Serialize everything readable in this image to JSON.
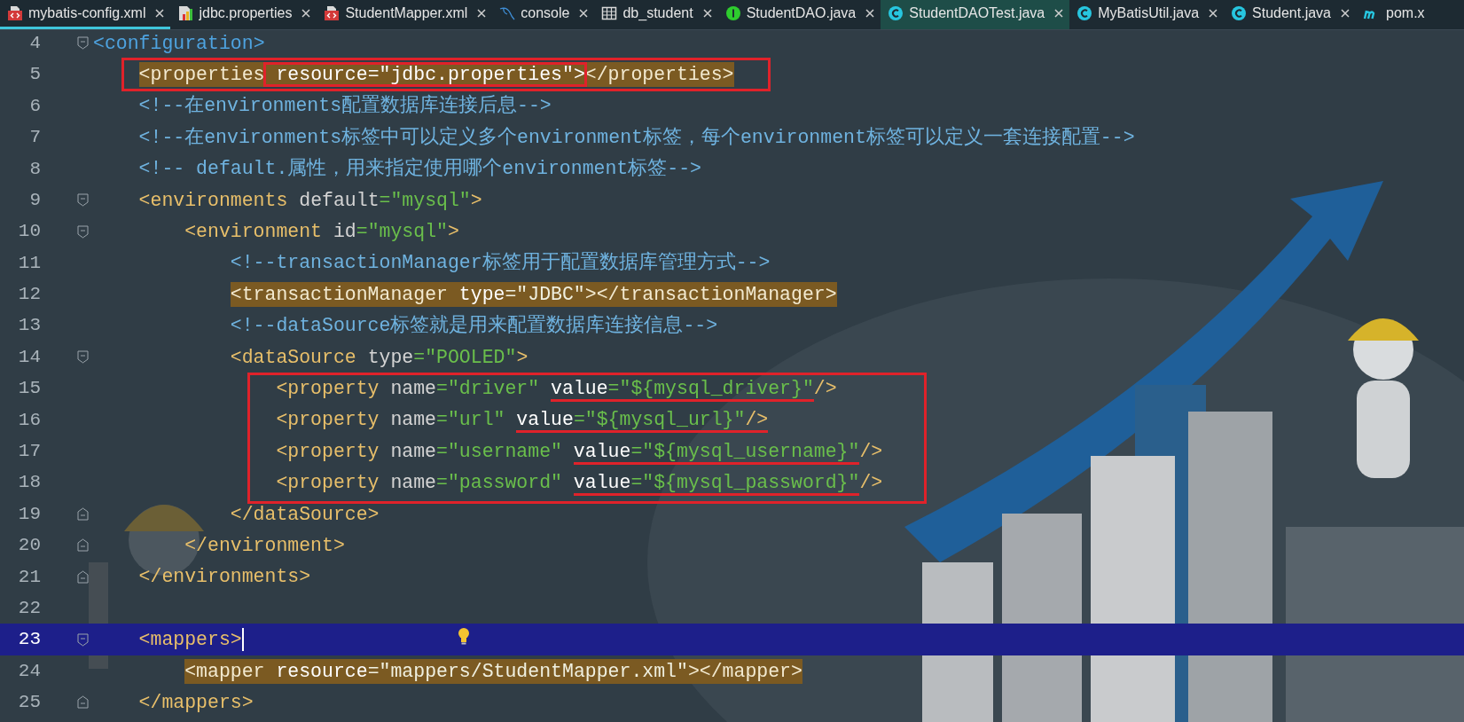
{
  "tabs": [
    {
      "label": "mybatis-config.xml",
      "kind": "xml",
      "selected": true,
      "highlighted": false
    },
    {
      "label": "jdbc.properties",
      "kind": "properties",
      "selected": false,
      "highlighted": false
    },
    {
      "label": "StudentMapper.xml",
      "kind": "xml",
      "selected": false,
      "highlighted": false
    },
    {
      "label": "console",
      "kind": "console",
      "selected": false,
      "highlighted": false
    },
    {
      "label": "db_student",
      "kind": "table",
      "selected": false,
      "highlighted": false
    },
    {
      "label": "StudentDAO.java",
      "kind": "interface",
      "selected": false,
      "highlighted": false
    },
    {
      "label": "StudentDAOTest.java",
      "kind": "class",
      "selected": false,
      "highlighted": true
    },
    {
      "label": "MyBatisUtil.java",
      "kind": "class",
      "selected": false,
      "highlighted": false
    },
    {
      "label": "Student.java",
      "kind": "class",
      "selected": false,
      "highlighted": false
    },
    {
      "label": "pom.x",
      "kind": "maven",
      "selected": false,
      "highlighted": false
    }
  ],
  "editor": {
    "lines": [
      {
        "kind": "line",
        "number": "4",
        "highlighted": false,
        "current": false,
        "tokens": [
          {
            "kind": "tag_blue",
            "text": "<configuration>"
          }
        ],
        "children": [
          {
            "kind": "annotation_box",
            "lines": [
              {
                "kind": "line",
                "number": "5",
                "highlighted": true,
                "current": false,
                "tokens": [
                  {
                    "kind": "tag",
                    "text": "<properties"
                  },
                  {
                    "kind": "attr",
                    "text": " resource=\"jdbc.properties\">",
                    "boxed": true
                  },
                  {
                    "kind": "tag",
                    "text": "</properties>"
                  }
                ]
              }
            ]
          },
          {
            "kind": "line",
            "number": "6",
            "highlighted": false,
            "current": false,
            "tokens": [
              {
                "kind": "comment",
                "text": "<!--在environments配置数据库连接后息-->"
              }
            ]
          },
          {
            "kind": "line",
            "number": "7",
            "highlighted": false,
            "current": false,
            "tokens": [
              {
                "kind": "comment",
                "text": "<!--在environments标签中可以定义多个environment标签，每个environment标签可以定义一套连接配置-->"
              }
            ]
          },
          {
            "kind": "line",
            "number": "8",
            "highlighted": false,
            "current": false,
            "tokens": [
              {
                "kind": "comment",
                "text": "<!-- default.属性，用来指定使用哪个environment标签-->"
              }
            ]
          },
          {
            "kind": "line",
            "number": "9",
            "highlighted": false,
            "current": false,
            "tokens": [
              {
                "kind": "tag",
                "text": "<environments"
              },
              {
                "kind": "attr",
                "text": " default"
              },
              {
                "kind": "value",
                "text": "=\"mysql\""
              },
              {
                "kind": "tag",
                "text": ">"
              }
            ],
            "children": [
              {
                "kind": "line",
                "number": "10",
                "highlighted": false,
                "current": false,
                "tokens": [
                  {
                    "kind": "tag",
                    "text": "<environment"
                  },
                  {
                    "kind": "attr",
                    "text": " id"
                  },
                  {
                    "kind": "value",
                    "text": "=\"mysql\""
                  },
                  {
                    "kind": "tag",
                    "text": ">"
                  }
                ],
                "children": [
                  {
                    "kind": "line",
                    "number": "11",
                    "highlighted": false,
                    "current": false,
                    "tokens": [
                      {
                        "kind": "comment",
                        "text": "<!--transactionManager标签用于配置数据库管理方式-->"
                      }
                    ]
                  },
                  {
                    "kind": "line",
                    "number": "12",
                    "highlighted": true,
                    "current": false,
                    "tokens": [
                      {
                        "kind": "tag",
                        "text": "<transactionManager"
                      },
                      {
                        "kind": "attr",
                        "text": " type"
                      },
                      {
                        "kind": "value",
                        "text": "=\"JDBC\""
                      },
                      {
                        "kind": "tag",
                        "text": "></transactionManager>"
                      }
                    ]
                  },
                  {
                    "kind": "line",
                    "number": "13",
                    "highlighted": false,
                    "current": false,
                    "tokens": [
                      {
                        "kind": "comment",
                        "text": "<!--dataSource标签就是用来配置数据库连接信息-->"
                      }
                    ]
                  },
                  {
                    "kind": "line",
                    "number": "14",
                    "highlighted": false,
                    "current": false,
                    "tokens": [
                      {
                        "kind": "tag",
                        "text": "<dataSource"
                      },
                      {
                        "kind": "attr",
                        "text": " type"
                      },
                      {
                        "kind": "value",
                        "text": "=\"POOLED\""
                      },
                      {
                        "kind": "tag",
                        "text": ">"
                      }
                    ],
                    "children": [
                      {
                        "kind": "annotation_box",
                        "lines": [
                          {
                            "kind": "line",
                            "number": "15",
                            "highlighted": false,
                            "current": false,
                            "tokens": [
                              {
                                "kind": "tag",
                                "text": "<property"
                              },
                              {
                                "kind": "attr",
                                "text": " name"
                              },
                              {
                                "kind": "value",
                                "text": "=\"driver\" "
                              },
                              {
                                "kind": "match",
                                "text": "value",
                                "underlined": true
                              },
                              {
                                "kind": "value",
                                "text": "=\"${mysql_driver}\"",
                                "underlined": true
                              },
                              {
                                "kind": "tag",
                                "text": "/>"
                              }
                            ]
                          },
                          {
                            "kind": "line",
                            "number": "16",
                            "highlighted": false,
                            "current": false,
                            "tokens": [
                              {
                                "kind": "tag",
                                "text": "<property"
                              },
                              {
                                "kind": "attr",
                                "text": " name"
                              },
                              {
                                "kind": "value",
                                "text": "=\"url\" "
                              },
                              {
                                "kind": "match",
                                "text": "value",
                                "underlined": true
                              },
                              {
                                "kind": "value",
                                "text": "=\"${mysql_url}\"",
                                "underlined": true
                              },
                              {
                                "kind": "tag",
                                "text": "/>",
                                "underlined": true
                              }
                            ]
                          },
                          {
                            "kind": "line",
                            "number": "17",
                            "highlighted": false,
                            "current": false,
                            "tokens": [
                              {
                                "kind": "tag",
                                "text": "<property"
                              },
                              {
                                "kind": "attr",
                                "text": " name"
                              },
                              {
                                "kind": "value",
                                "text": "=\"username\" "
                              },
                              {
                                "kind": "match",
                                "text": "value",
                                "underlined": true
                              },
                              {
                                "kind": "value",
                                "text": "=\"${mysql_username}\"",
                                "underlined": true
                              },
                              {
                                "kind": "tag",
                                "text": "/>"
                              }
                            ]
                          },
                          {
                            "kind": "line",
                            "number": "18",
                            "highlighted": false,
                            "current": false,
                            "tokens": [
                              {
                                "kind": "tag",
                                "text": "<property"
                              },
                              {
                                "kind": "attr",
                                "text": " name"
                              },
                              {
                                "kind": "value",
                                "text": "=\"password\" "
                              },
                              {
                                "kind": "match",
                                "text": "value",
                                "underlined": true
                              },
                              {
                                "kind": "value",
                                "text": "=\"${mysql_password}\"",
                                "underlined": true
                              },
                              {
                                "kind": "tag",
                                "text": "/>"
                              }
                            ]
                          }
                        ]
                      }
                    ],
                    "closing": {
                      "number": "19",
                      "highlighted": false,
                      "current": false,
                      "tokens": [
                        {
                          "kind": "tag",
                          "text": "</dataSource>"
                        }
                      ]
                    }
                  }
                ],
                "closing": {
                  "number": "20",
                  "highlighted": false,
                  "current": false,
                  "tokens": [
                    {
                      "kind": "tag",
                      "text": "</environment>"
                    }
                  ]
                }
              }
            ],
            "closing": {
              "number": "21",
              "highlighted": false,
              "current": false,
              "tokens": [
                {
                  "kind": "tag",
                  "text": "</environments>"
                }
              ]
            }
          },
          {
            "kind": "line",
            "number": "22",
            "current": false
          },
          {
            "kind": "line",
            "number": "23",
            "highlighted": false,
            "current": true,
            "tokens": [
              {
                "kind": "tag",
                "text": "<mappers>"
              }
            ],
            "children": [
              {
                "kind": "line",
                "number": "24",
                "highlighted": true,
                "current": false,
                "tokens": [
                  {
                    "kind": "tag",
                    "text": "<mapper"
                  },
                  {
                    "kind": "attr",
                    "text": " resource"
                  },
                  {
                    "kind": "value",
                    "text": "=\"mappers/StudentMapper.xml\""
                  },
                  {
                    "kind": "tag",
                    "text": "></mapper>"
                  }
                ]
              }
            ],
            "closing": {
              "number": "25",
              "highlighted": false,
              "current": false,
              "tokens": [
                {
                  "kind": "tag",
                  "text": "</mappers>"
                }
              ]
            }
          }
        ]
      }
    ]
  }
}
